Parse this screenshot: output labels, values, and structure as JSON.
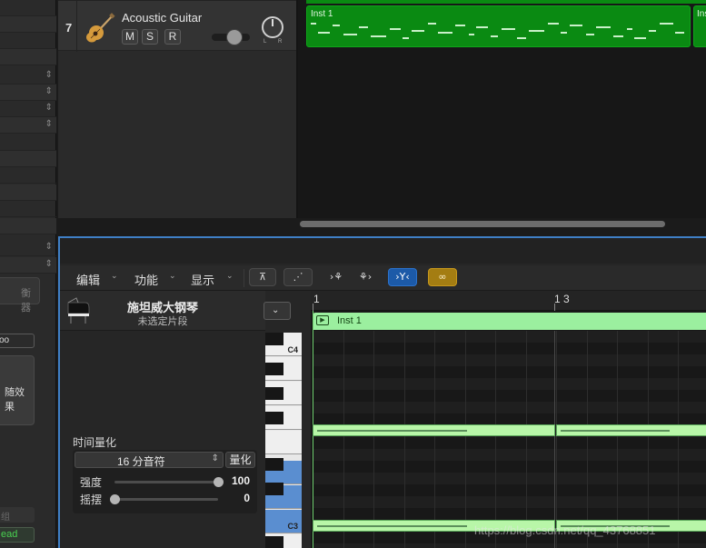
{
  "inspector": {
    "button_partial": "衡器",
    "fx_partial": "随效果",
    "group_partial": "组",
    "automation_partial": "ead"
  },
  "track": {
    "number": "7",
    "name": "Acoustic Guitar",
    "mute": "M",
    "solo": "S",
    "record": "R",
    "pan_left": "L",
    "pan_right": "R",
    "region_label": "Inst 1",
    "next_region_label": "Ins"
  },
  "editor": {
    "menus": [
      {
        "label": "编辑"
      },
      {
        "label": "功能"
      },
      {
        "label": "显示"
      }
    ],
    "instrument_name": "施坦威大钢琴",
    "instrument_sub": "未选定片段",
    "quantize": {
      "title": "时间量化",
      "value": "16 分音符",
      "button": "量化",
      "strength_label": "强度",
      "strength_value": "100",
      "swing_label": "摇摆",
      "swing_value": "0",
      "strength": 100,
      "swing": 0
    },
    "keys": {
      "c4": "C4",
      "c3": "C3"
    },
    "ruler": {
      "bar1": "1",
      "bar13": "1 3"
    },
    "region_label": "Inst 1"
  },
  "watermark": "https://blog.csdn.net/qq_43768851",
  "colors": {
    "region_green": "#0a8a12",
    "editor_region": "#9bef9f",
    "editor_border": "#3f7fc6",
    "catch_blue": "#1c5aa8",
    "link_gold": "#a47d12",
    "automation_green": "#48d04f"
  }
}
